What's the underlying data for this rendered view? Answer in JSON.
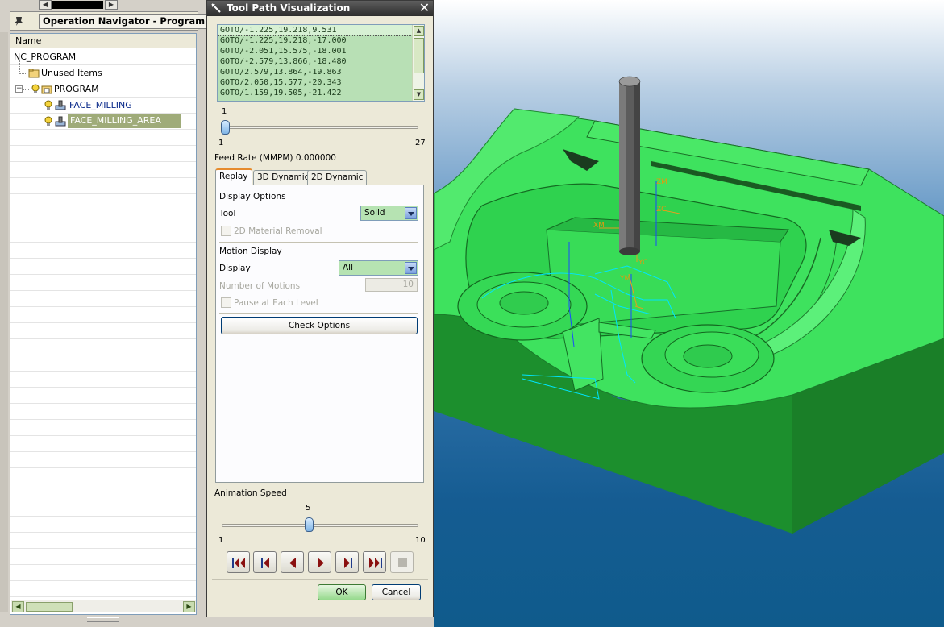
{
  "navigator": {
    "title": "Operation Navigator - Program Or...",
    "column_header": "Name",
    "items": [
      {
        "label": "NC_PROGRAM"
      },
      {
        "label": "Unused Items"
      },
      {
        "label": "PROGRAM"
      },
      {
        "label": "FACE_MILLING"
      },
      {
        "label": "FACE_MILLING_AREA"
      }
    ]
  },
  "dialog": {
    "title": "Tool Path Visualization",
    "goto_list": [
      "GOTO/-1.225,19.218,9.531",
      "GOTO/-1.225,19.218,-17.000",
      "GOTO/-2.051,15.575,-18.001",
      "GOTO/-2.579,13.866,-18.480",
      "GOTO/2.579,13.864,-19.863",
      "GOTO/2.050,15.577,-20.343",
      "GOTO/1.159,19.505,-21.422"
    ],
    "motion_slider": {
      "value": "1",
      "min": "1",
      "max": "27",
      "fraction": 0.0
    },
    "feed_rate": "Feed Rate (MMPM) 0.000000",
    "tabs": [
      "Replay",
      "3D Dynamic",
      "2D Dynamic"
    ],
    "active_tab": "Replay",
    "display_options_label": "Display Options",
    "tool_label": "Tool",
    "tool_value": "Solid",
    "material_removal_label": "2D Material Removal",
    "motion_display_label": "Motion Display",
    "display_label": "Display",
    "display_value": "All",
    "num_motions_label": "Number of Motions",
    "num_motions_value": "10",
    "pause_label": "Pause at Each Level",
    "check_options_label": "Check Options",
    "animation_speed_label": "Animation Speed",
    "speed_slider": {
      "value": "5",
      "min": "1",
      "max": "10",
      "fraction": 0.444
    },
    "ok_label": "OK",
    "cancel_label": "Cancel"
  },
  "viewport": {
    "axis_labels": [
      "ZM",
      "ZC",
      "XM",
      "XC",
      "YC",
      "YM"
    ]
  },
  "colors": {
    "part_green": "#38e05a",
    "selection": "#9fab79",
    "list_bg": "#b8e0b5"
  }
}
